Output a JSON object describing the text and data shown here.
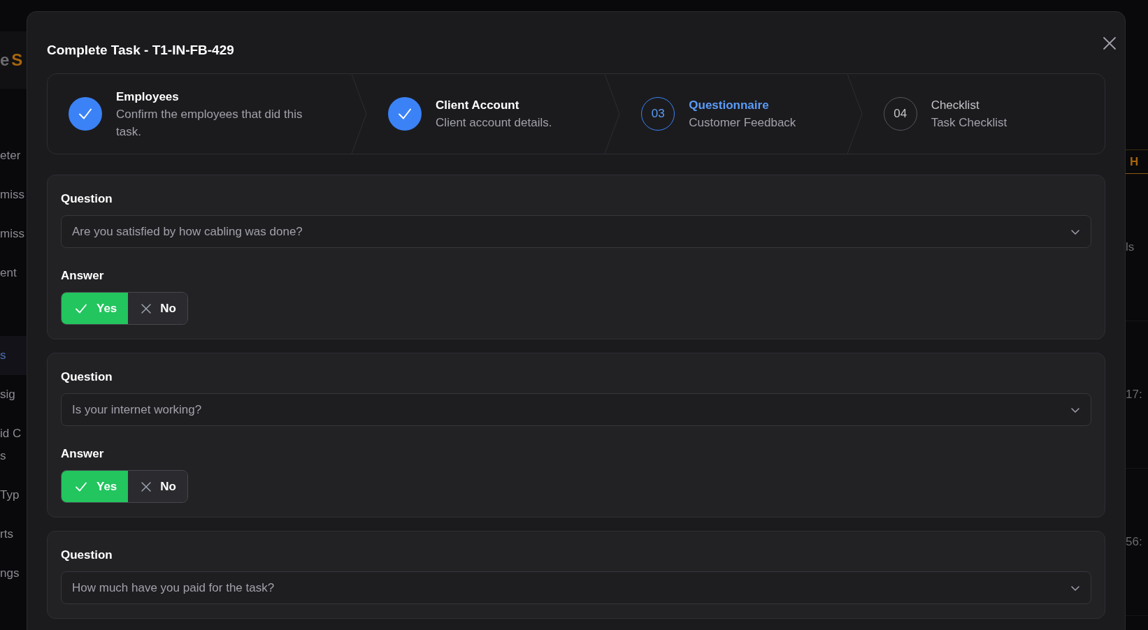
{
  "background": {
    "header_fragments": [
      "e",
      "S"
    ],
    "nav_groups": [
      [
        {
          "lines": [
            "eter"
          ],
          "selected": false
        },
        {
          "lines": [
            "miss"
          ],
          "selected": false
        },
        {
          "lines": [
            "miss"
          ],
          "selected": false
        },
        {
          "lines": [
            "ent"
          ],
          "selected": false
        }
      ],
      [
        {
          "lines": [
            "s"
          ],
          "selected": true
        },
        {
          "lines": [
            "sig"
          ],
          "selected": false
        },
        {
          "lines": [
            "id C",
            "s"
          ],
          "selected": false
        },
        {
          "lines": [
            "Typ"
          ],
          "selected": false
        },
        {
          "lines": [
            "rts"
          ],
          "selected": false
        },
        {
          "lines": [
            "ngs"
          ],
          "selected": false
        }
      ]
    ],
    "right_tab": "H",
    "right_cells": [
      "ls",
      "17:",
      "56:"
    ]
  },
  "modal": {
    "title": "Complete Task - T1-IN-FB-429",
    "steps": [
      {
        "completed": true,
        "selected": false,
        "title": "Employees",
        "subtitle": "Confirm the employees that did this task."
      },
      {
        "completed": true,
        "selected": false,
        "title": "Client Account",
        "subtitle": "Client account details."
      },
      {
        "completed": false,
        "selected": true,
        "number": "03",
        "title": "Questionnaire",
        "subtitle": "Customer Feedback"
      },
      {
        "completed": false,
        "selected": false,
        "number": "04",
        "title": "Checklist",
        "subtitle": "Task Checklist"
      }
    ],
    "questions": [
      {
        "question_label": "Question",
        "question": "Are you satisfied by how cabling was done?",
        "answer_label": "Answer",
        "options": [
          {
            "kind": "yes",
            "label": "Yes",
            "selected": true
          },
          {
            "kind": "no",
            "label": "No",
            "selected": false
          }
        ]
      },
      {
        "question_label": "Question",
        "question": "Is your internet working?",
        "answer_label": "Answer",
        "options": [
          {
            "kind": "yes",
            "label": "Yes",
            "selected": true
          },
          {
            "kind": "no",
            "label": "No",
            "selected": false
          }
        ]
      },
      {
        "question_label": "Question",
        "question": "How much have you paid for the task?"
      }
    ]
  }
}
